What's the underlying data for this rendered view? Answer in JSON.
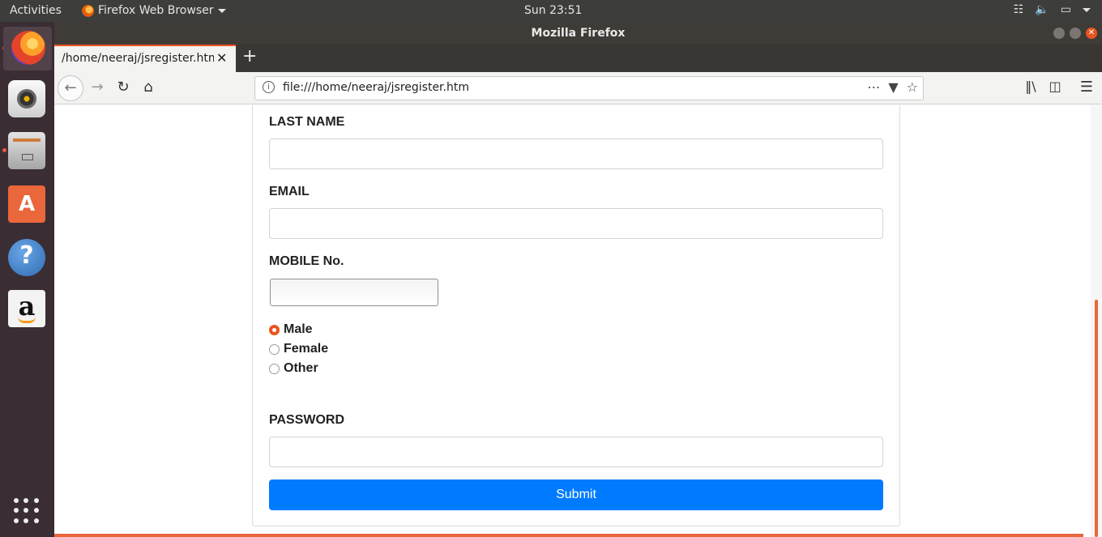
{
  "topbar": {
    "activities": "Activities",
    "app_menu": "Firefox Web Browser",
    "clock": "Sun 23:51"
  },
  "window": {
    "title": "Mozilla Firefox"
  },
  "tabs": [
    {
      "label": "/home/neeraj/jsregister.htm"
    }
  ],
  "urlbar": {
    "url": "file:///home/neeraj/jsregister.htm"
  },
  "form": {
    "last_name_label": "LAST NAME",
    "email_label": "EMAIL",
    "mobile_label": "MOBILE No.",
    "gender_options": [
      {
        "label": "Male",
        "checked": true
      },
      {
        "label": "Female",
        "checked": false
      },
      {
        "label": "Other",
        "checked": false
      }
    ],
    "password_label": "PASSWORD",
    "submit_label": "Submit"
  },
  "colors": {
    "accent": "#e95420",
    "submit": "#007bff"
  }
}
